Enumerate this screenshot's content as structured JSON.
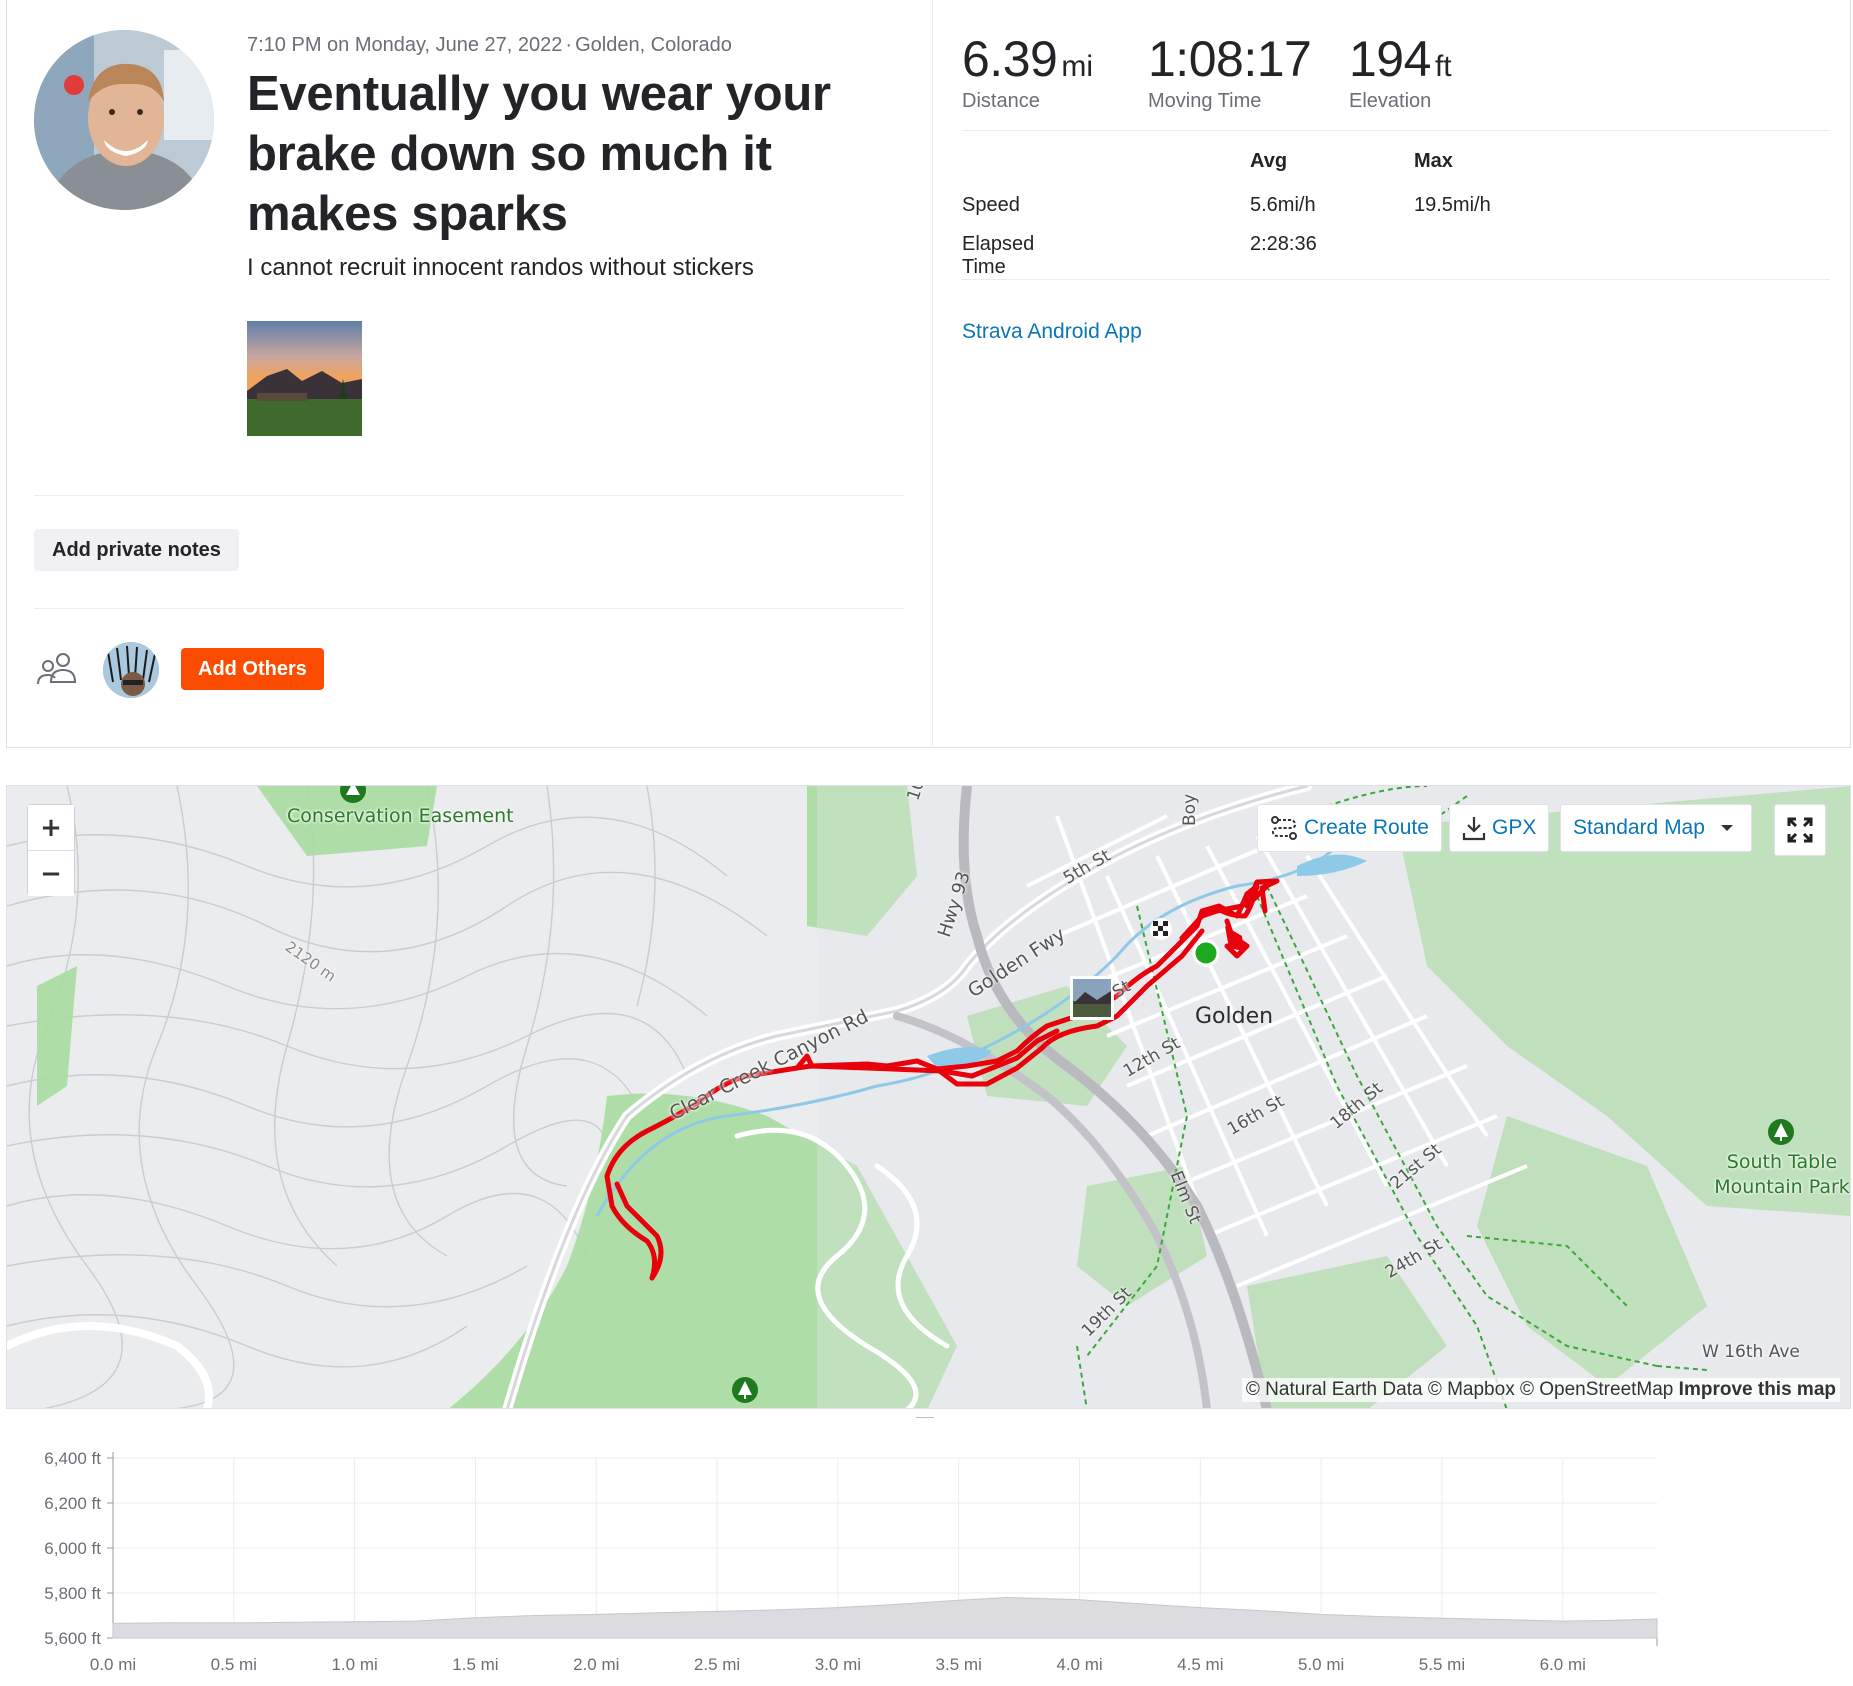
{
  "activity": {
    "time": "7:10 PM on Monday, June 27, 2022",
    "location": "Golden, Colorado",
    "title": "Eventually you wear your brake down so much it makes sparks",
    "description": "I cannot recruit innocent randos without stickers",
    "private_notes_label": "Add private notes",
    "add_others_label": "Add Others"
  },
  "stats": {
    "distance": {
      "value": "6.39",
      "unit": "mi",
      "label": "Distance"
    },
    "moving_time": {
      "value": "1:08:17",
      "label": "Moving Time"
    },
    "elevation": {
      "value": "194",
      "unit": "ft",
      "label": "Elevation"
    },
    "table": {
      "col_avg": "Avg",
      "col_max": "Max",
      "rows": [
        {
          "label": "Speed",
          "avg": "5.6mi/h",
          "max": "19.5mi/h"
        },
        {
          "label": "Elapsed Time",
          "avg": "2:28:36",
          "max": ""
        }
      ]
    },
    "device": "Strava Android App"
  },
  "map": {
    "zoom_in": "+",
    "zoom_out": "−",
    "create_route": "Create Route",
    "gpx": "GPX",
    "map_style": "Standard Map",
    "attribution": "© Natural Earth Data © Mapbox © OpenStreetMap",
    "improve": "Improve this map",
    "labels": {
      "city": "Golden",
      "conservation": "Conservation Easement",
      "south_table": "South Table Mountain Park",
      "clear_creek": "Clear Creek Canyon Rd",
      "golden_fwy": "Golden Fwy",
      "hwy93": "Hwy 93",
      "fifth_st": "5th St",
      "twelfth_st": "12th St",
      "sixteenth_st": "16th St",
      "eighteenth_st": "18th St",
      "twentyfirst_st": "21st St",
      "twentyfourth_st": "24th St",
      "nineteenth_st": "19th St",
      "elm_st": "Elm St",
      "w16th_ave": "W 16th Ave",
      "contour": "2120 m",
      "boy": "Boy",
      "st_partial": "St",
      "edge_partial": "10"
    },
    "colors": {
      "route": "#e8000b",
      "park": "#a9dca0",
      "start": "#1ea81e"
    }
  },
  "chart_data": {
    "type": "area",
    "x_unit": "mi",
    "y_unit": "ft",
    "x_ticks": [
      "0.0 mi",
      "0.5 mi",
      "1.0 mi",
      "1.5 mi",
      "2.0 mi",
      "2.5 mi",
      "3.0 mi",
      "3.5 mi",
      "4.0 mi",
      "4.5 mi",
      "5.0 mi",
      "5.5 mi",
      "6.0 mi"
    ],
    "y_ticks": [
      "6,400 ft",
      "6,200 ft",
      "6,000 ft",
      "5,800 ft",
      "5,600 ft"
    ],
    "xlim": [
      0,
      6.39
    ],
    "ylim": [
      5600,
      6400
    ],
    "grid": true,
    "x": [
      0.0,
      0.25,
      0.5,
      0.75,
      1.0,
      1.25,
      1.5,
      1.75,
      2.0,
      2.25,
      2.5,
      2.75,
      3.0,
      3.25,
      3.5,
      3.7,
      4.0,
      4.25,
      4.5,
      4.75,
      5.0,
      5.25,
      5.5,
      5.75,
      6.0,
      6.2,
      6.39
    ],
    "y": [
      5665,
      5668,
      5667,
      5670,
      5672,
      5675,
      5690,
      5700,
      5705,
      5712,
      5718,
      5725,
      5735,
      5750,
      5768,
      5780,
      5770,
      5752,
      5735,
      5722,
      5705,
      5695,
      5688,
      5682,
      5675,
      5678,
      5685
    ]
  }
}
